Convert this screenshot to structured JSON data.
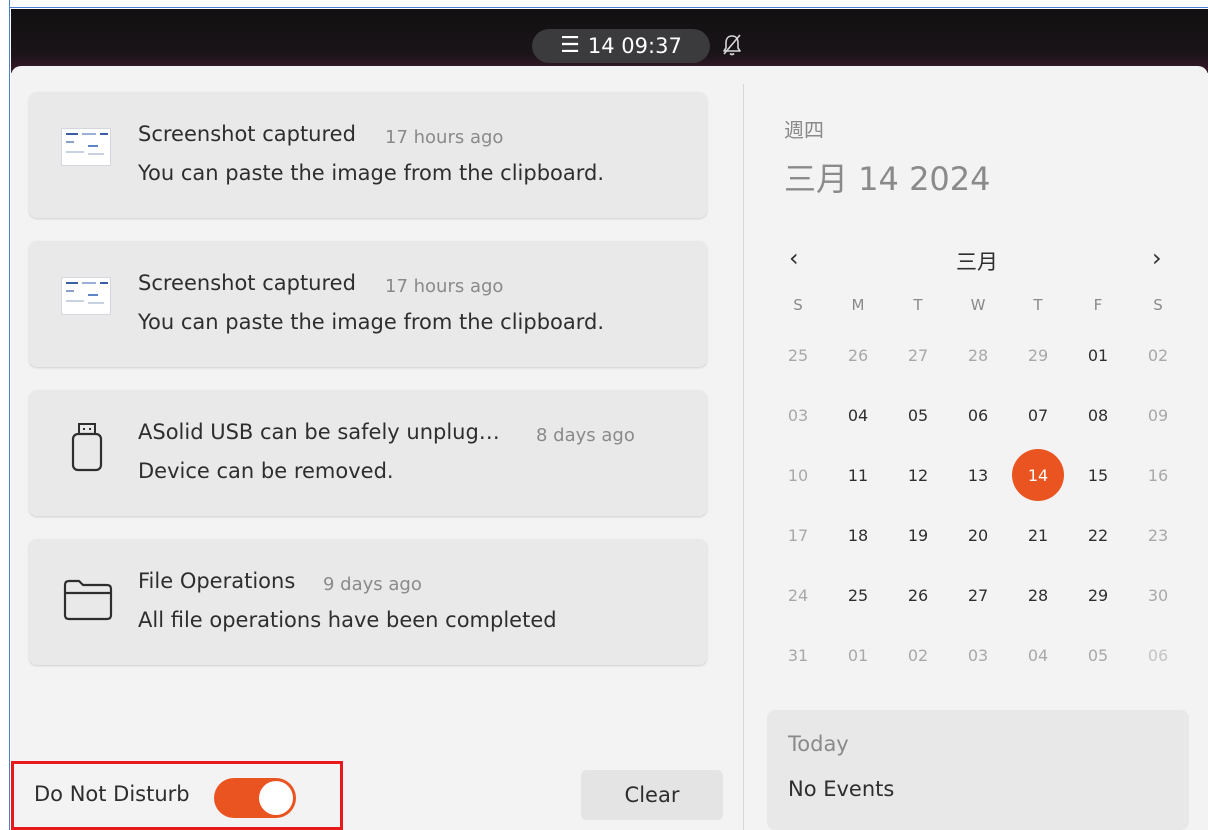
{
  "topbar": {
    "menu_glyph": "☰",
    "clock": "14  09:37",
    "dnd_icon": "bell-off-icon"
  },
  "notifications": [
    {
      "icon": "screenshot-thumbnail-icon",
      "title": "Screenshot captured",
      "time": "17 hours ago",
      "body": "You can paste the image from the clipboard."
    },
    {
      "icon": "screenshot-thumbnail-icon",
      "title": "Screenshot captured",
      "time": "17 hours ago",
      "body": "You can paste the image from the clipboard."
    },
    {
      "icon": "usb-drive-icon",
      "title": "ASolid USB can be safely unplug…",
      "time": "8 days ago",
      "body": "Device can be removed."
    },
    {
      "icon": "folder-icon",
      "title": "File Operations",
      "time": "9 days ago",
      "body": "All file operations have been completed"
    }
  ],
  "dnd": {
    "label": "Do Not Disturb",
    "enabled": true
  },
  "clear_label": "Clear",
  "date_header": {
    "weekday": "週四",
    "full_date": "三月 14 2024"
  },
  "calendar": {
    "month_label": "三月",
    "prev_label": "‹",
    "next_label": "›",
    "day_headers": [
      "S",
      "M",
      "T",
      "W",
      "T",
      "F",
      "S"
    ],
    "weeks": [
      [
        "25",
        "26",
        "27",
        "28",
        "29",
        "01",
        "02"
      ],
      [
        "03",
        "04",
        "05",
        "06",
        "07",
        "08",
        "09"
      ],
      [
        "10",
        "11",
        "12",
        "13",
        "14",
        "15",
        "16"
      ],
      [
        "17",
        "18",
        "19",
        "20",
        "21",
        "22",
        "23"
      ],
      [
        "24",
        "25",
        "26",
        "27",
        "28",
        "29",
        "30"
      ],
      [
        "31",
        "01",
        "02",
        "03",
        "04",
        "05",
        "06"
      ]
    ],
    "today": "14"
  },
  "events": {
    "title": "Today",
    "empty_text": "No Events"
  },
  "colors": {
    "accent": "#e95420",
    "highlight_border": "#e8191c"
  }
}
